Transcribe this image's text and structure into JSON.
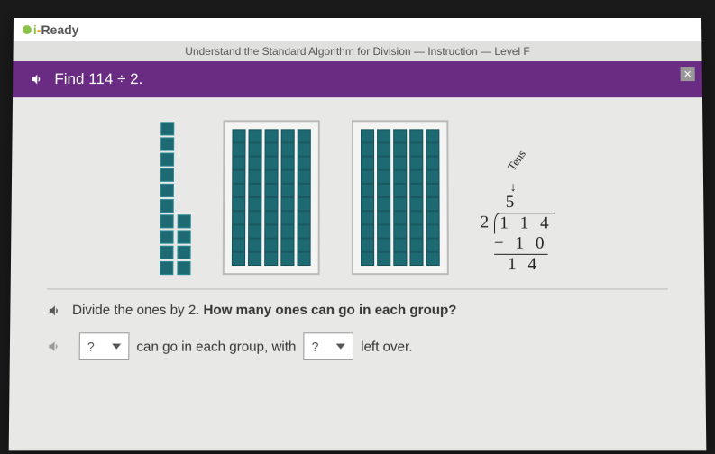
{
  "brand": {
    "i": "i",
    "dash": "-",
    "ready": "Ready"
  },
  "breadcrumb": "Understand the Standard Algorithm for Division — Instruction — Level F",
  "header": {
    "instruction": "Find 114 ÷ 2."
  },
  "close": "✕",
  "longdiv": {
    "tens_label": "Tens",
    "arrow": "↓",
    "quotient": "5",
    "divisor": "2",
    "dividend": "1 1 4",
    "subtract": "− 1 0",
    "remainder": "1 4"
  },
  "question": {
    "prompt_prefix": "Divide the ones by 2. ",
    "prompt_bold": "How many ones can go in each group?"
  },
  "answer": {
    "dropdown1": "?",
    "text1": "can go in each group, with",
    "dropdown2": "?",
    "text2": "left over."
  }
}
